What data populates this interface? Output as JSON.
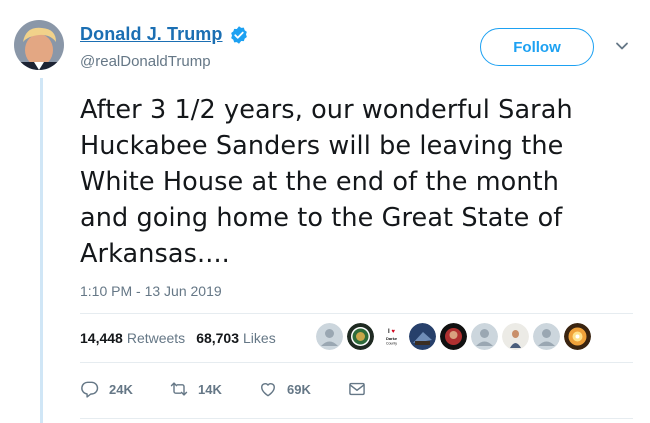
{
  "author": {
    "display_name": "Donald J. Trump",
    "handle": "@realDonaldTrump",
    "verified": true
  },
  "follow_label": "Follow",
  "tweet": {
    "text": "After 3 1/2 years, our wonderful Sarah\nHuckabee Sanders will be leaving the\nWhite House at the end of the month\nand going home to the Great State of\nArkansas....",
    "timestamp": "1:10 PM - 13 Jun 2019"
  },
  "stats": {
    "retweets_count": "14,448",
    "retweets_label": "Retweets",
    "likes_count": "68,703",
    "likes_label": "Likes"
  },
  "liker_avatar_badge_text": "I ♥ Darke County",
  "actions": {
    "reply_count": "24K",
    "retweet_count": "14K",
    "like_count": "69K"
  },
  "colors": {
    "accent": "#1da1f2",
    "name_link": "#1b6fb3",
    "secondary_text": "#657786",
    "thread_line": "#d0e6f6"
  },
  "icons": [
    "verified-badge-icon",
    "chevron-down-icon",
    "reply-icon",
    "retweet-icon",
    "like-heart-icon",
    "direct-message-icon"
  ]
}
